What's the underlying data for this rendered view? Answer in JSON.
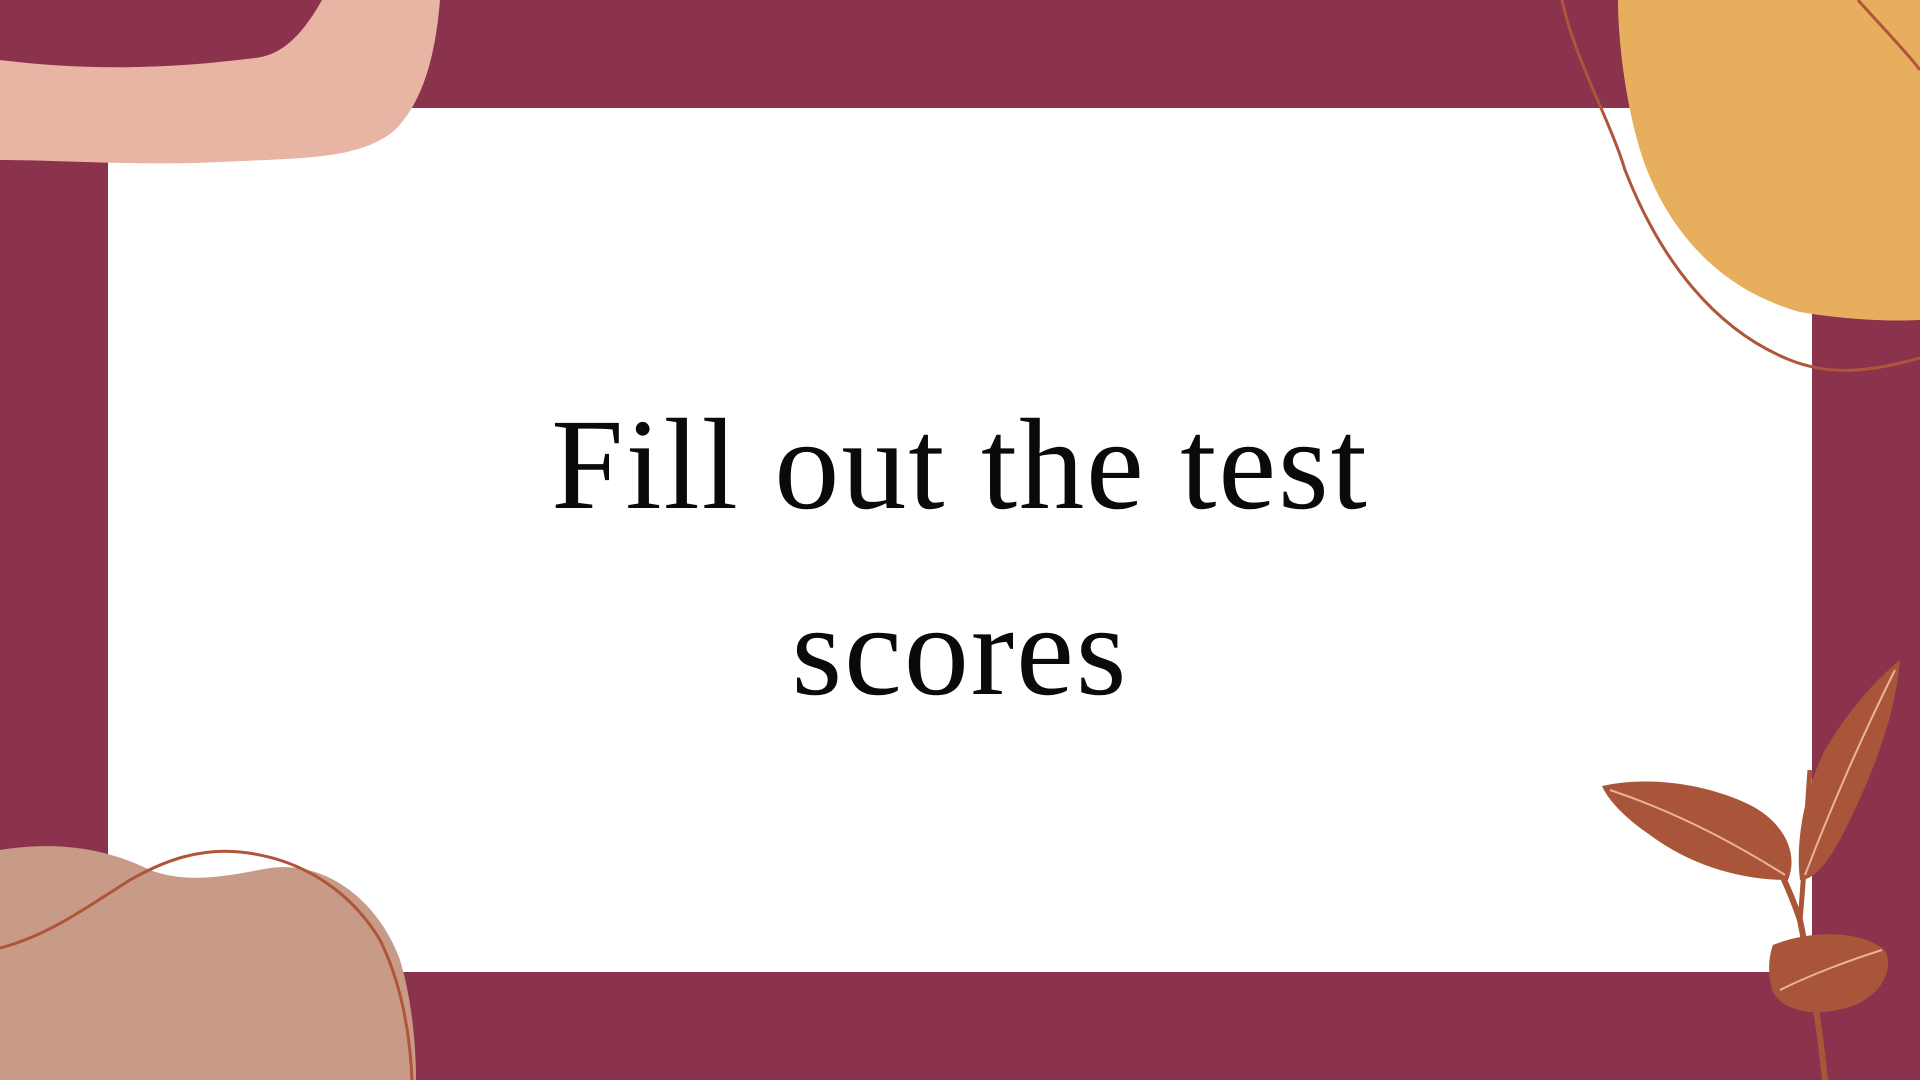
{
  "slide": {
    "title_line_1": "Fill out the test",
    "title_line_2": "scores"
  },
  "colors": {
    "background_frame": "#8b324c",
    "panel": "#ffffff",
    "blob_top_left": "#e8b4a4",
    "blob_top_right": "#e6ae5d",
    "blob_bottom_left": "#c79b87",
    "curve_line": "#b0543a",
    "leaf": "#a8553a",
    "title_text": "#0a0a0a"
  },
  "icons": {
    "top_left": "abstract-blob",
    "top_right": "abstract-blob-with-line",
    "bottom_left": "abstract-blob-with-line",
    "bottom_right": "leaf-branch"
  }
}
